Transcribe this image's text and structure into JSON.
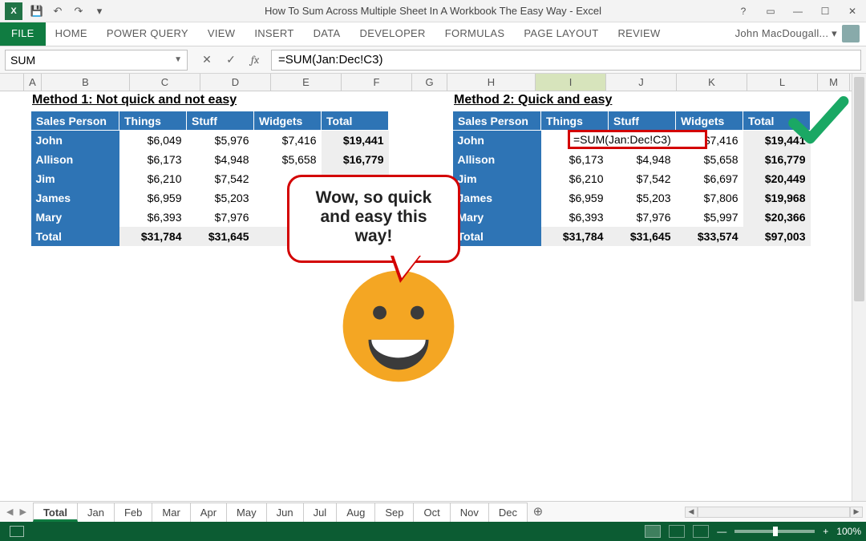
{
  "titlebar": {
    "app_icon_text": "X",
    "title": "How To Sum Across Multiple Sheet In A Workbook The Easy Way - Excel"
  },
  "qat": {
    "save": "💾",
    "undo": "↶",
    "redo": "↷",
    "more": "▾"
  },
  "win": {
    "help": "?",
    "full": "▭",
    "min": "—",
    "max": "☐",
    "close": "✕"
  },
  "ribbon": {
    "file": "FILE",
    "tabs": [
      "HOME",
      "POWER QUERY",
      "VIEW",
      "INSERT",
      "DATA",
      "DEVELOPER",
      "FORMULAS",
      "PAGE LAYOUT",
      "REVIEW"
    ],
    "user": "John MacDougall... ▾"
  },
  "formula_bar": {
    "name_box": "SUM",
    "cancel": "✕",
    "enter": "✓",
    "fx": "fx",
    "formula": "=SUM(Jan:Dec!C3)"
  },
  "columns": [
    "A",
    "B",
    "C",
    "D",
    "E",
    "F",
    "G",
    "H",
    "I",
    "J",
    "K",
    "L",
    "M"
  ],
  "selected_col": "I",
  "method1": {
    "caption": "Method 1: Not quick and not easy",
    "headers": [
      "Sales Person",
      "Things",
      "Stuff",
      "Widgets",
      "Total"
    ],
    "rows": [
      {
        "name": "John",
        "c": "$6,049",
        "d": "$5,976",
        "e": "$7,416",
        "f": "$19,441"
      },
      {
        "name": "Allison",
        "c": "$6,173",
        "d": "$4,948",
        "e": "$5,658",
        "f": "$16,779"
      },
      {
        "name": "Jim",
        "c": "$6,210",
        "d": "$7,542",
        "e": "",
        "f": ""
      },
      {
        "name": "James",
        "c": "$6,959",
        "d": "$5,203",
        "e": "",
        "f": ""
      },
      {
        "name": "Mary",
        "c": "$6,393",
        "d": "$7,976",
        "e": "",
        "f": ""
      }
    ],
    "total": {
      "name": "Total",
      "c": "$31,784",
      "d": "$31,645",
      "e": "",
      "f": ""
    }
  },
  "method2": {
    "caption": "Method 2: Quick and easy",
    "headers": [
      "Sales Person",
      "Things",
      "Stuff",
      "Widgets",
      "Total"
    ],
    "rows": [
      {
        "name": "John",
        "c": "",
        "d": "",
        "e": "$7,416",
        "f": "$19,441"
      },
      {
        "name": "Allison",
        "c": "$6,173",
        "d": "$4,948",
        "e": "$5,658",
        "f": "$16,779"
      },
      {
        "name": "Jim",
        "c": "$6,210",
        "d": "$7,542",
        "e": "$6,697",
        "f": "$20,449"
      },
      {
        "name": "James",
        "c": "$6,959",
        "d": "$5,203",
        "e": "$7,806",
        "f": "$19,968"
      },
      {
        "name": "Mary",
        "c": "$6,393",
        "d": "$7,976",
        "e": "$5,997",
        "f": "$20,366"
      }
    ],
    "total": {
      "name": "Total",
      "c": "$31,784",
      "d": "$31,645",
      "e": "$33,574",
      "f": "$97,003"
    }
  },
  "inline_formula": "=SUM(Jan:Dec!C3)",
  "speech_text": "Wow, so quick and easy this way!",
  "sheets": {
    "active": "Total",
    "tabs": [
      "Total",
      "Jan",
      "Feb",
      "Mar",
      "Apr",
      "May",
      "Jun",
      "Jul",
      "Aug",
      "Sep",
      "Oct",
      "Nov",
      "Dec"
    ],
    "add": "⊕"
  },
  "status": {
    "zoom": "100%",
    "minus": "—",
    "plus": "+"
  }
}
